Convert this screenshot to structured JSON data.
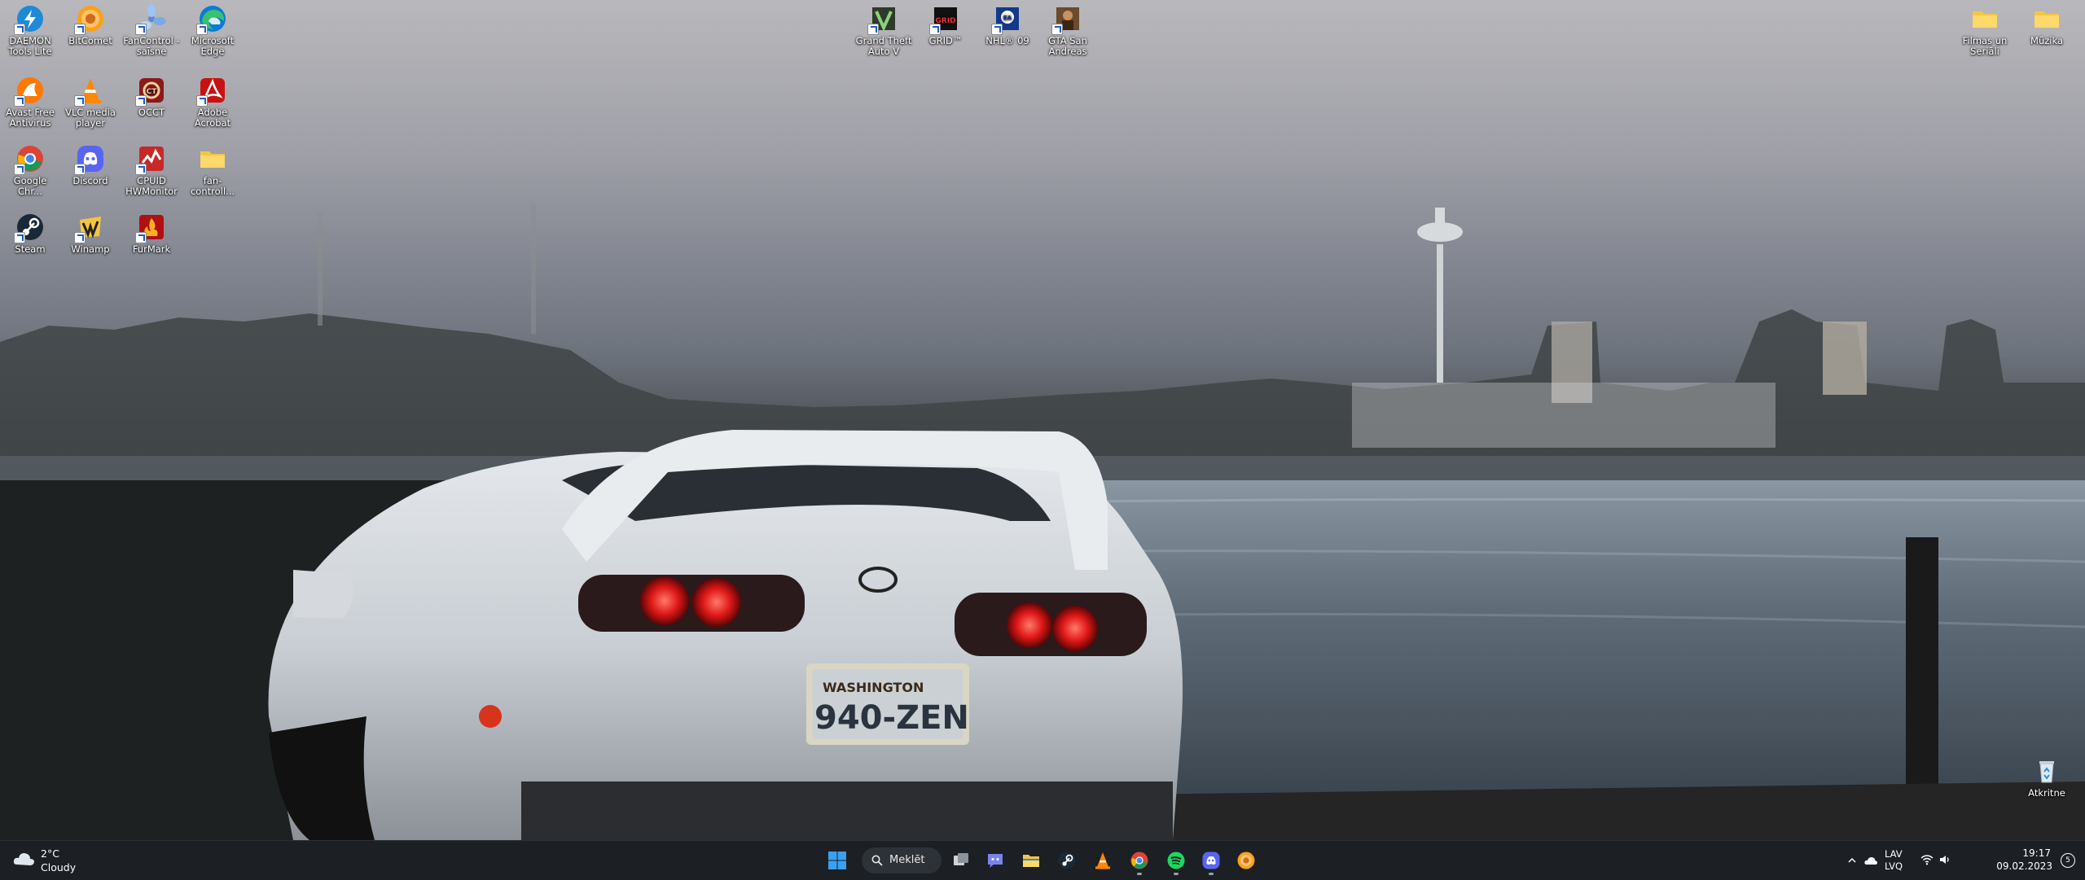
{
  "desktop": {
    "icons_left": [
      {
        "label": "DAEMON Tools Lite",
        "icon": "daemon-tools-icon"
      },
      {
        "label": "BitComet",
        "icon": "bitcomet-icon"
      },
      {
        "label": "FanControl - saīsne",
        "icon": "fancontrol-icon"
      },
      {
        "label": "Microsoft Edge",
        "icon": "edge-icon"
      },
      {
        "label": "Avast Free Antivirus",
        "icon": "avast-icon"
      },
      {
        "label": "VLC media player",
        "icon": "vlc-icon"
      },
      {
        "label": "OCCT",
        "icon": "occt-icon"
      },
      {
        "label": "Adobe Acrobat",
        "icon": "acrobat-icon"
      },
      {
        "label": "Google Chr...",
        "icon": "chrome-icon"
      },
      {
        "label": "Discord",
        "icon": "discord-icon"
      },
      {
        "label": "CPUID HWMonitor",
        "icon": "hwmonitor-icon"
      },
      {
        "label": "fan-controll...",
        "icon": "folder-icon"
      },
      {
        "label": "Steam",
        "icon": "steam-icon"
      },
      {
        "label": "Winamp",
        "icon": "winamp-icon"
      },
      {
        "label": "FurMark",
        "icon": "furmark-icon"
      }
    ],
    "icons_center": [
      {
        "label": "Grand Theft Auto V",
        "icon": "gta-v-icon"
      },
      {
        "label": "GRID™",
        "icon": "grid-icon"
      },
      {
        "label": "NHL® 09",
        "icon": "nhl09-icon"
      },
      {
        "label": "GTA San Andreas",
        "icon": "gta-sa-icon"
      }
    ],
    "icons_right": [
      {
        "label": "Filmas un Seriāli",
        "icon": "folder-icon"
      },
      {
        "label": "Mūzika",
        "icon": "folder-icon"
      }
    ],
    "recycle_bin": {
      "label": "Atkritne",
      "icon": "recycle-bin-icon"
    },
    "wallpaper": {
      "plate_state": "WASHINGTON",
      "plate_number": "940-ZEN"
    }
  },
  "taskbar": {
    "weather": {
      "temp": "2°C",
      "desc": "Cloudy",
      "icon": "cloud-icon"
    },
    "search_label": "Meklēt",
    "apps": [
      {
        "name": "start",
        "icon": "windows-start-icon"
      },
      {
        "name": "search",
        "icon": "search-icon"
      },
      {
        "name": "task-view",
        "icon": "task-view-icon"
      },
      {
        "name": "teams-chat",
        "icon": "chat-icon"
      },
      {
        "name": "file-explorer",
        "icon": "folder-icon"
      },
      {
        "name": "steam",
        "icon": "steam-icon"
      },
      {
        "name": "vlc",
        "icon": "vlc-icon"
      },
      {
        "name": "chrome",
        "icon": "chrome-icon"
      },
      {
        "name": "spotify",
        "icon": "spotify-icon"
      },
      {
        "name": "discord",
        "icon": "discord-icon"
      },
      {
        "name": "bitcomet",
        "icon": "bitcomet-icon"
      }
    ],
    "tray": {
      "lang_top": "LAV",
      "lang_bottom": "LVQ",
      "time": "19:17",
      "date": "09.02.2023",
      "notifications": "5"
    }
  },
  "colors": {
    "taskbar": "#1c1f24",
    "win_blue": "#3aa0f0",
    "search_bg": "#2d3138"
  }
}
